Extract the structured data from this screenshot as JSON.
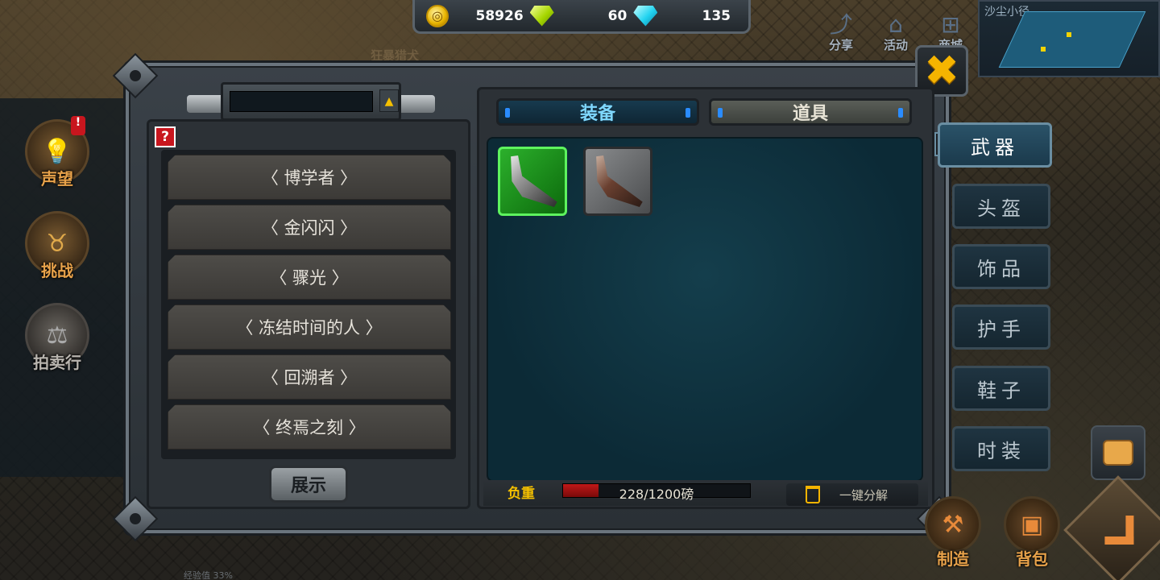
{
  "currency": {
    "gold": "58926",
    "green_gems": "60",
    "blue_gems": "135"
  },
  "top_menu": [
    {
      "label": "分享",
      "icon": "share-icon"
    },
    {
      "label": "活动",
      "icon": "event-gift-icon"
    },
    {
      "label": "商城",
      "icon": "shop-cart-icon"
    }
  ],
  "minimap": {
    "title": "沙尘小径"
  },
  "background": {
    "faded_label": "狂暴猎犬",
    "xp_label": "经验值 33%"
  },
  "side_menu": [
    {
      "label": "声望",
      "icon": "reputation-lightbulb-icon",
      "alert": "!"
    },
    {
      "label": "挑战",
      "icon": "challenge-bull-icon"
    },
    {
      "label": "拍卖行",
      "icon": "auction-scales-icon"
    }
  ],
  "title_panel": {
    "help_label": "?",
    "dropdown_icon": "▲",
    "titles": [
      "〈 博学者 〉",
      "〈 金闪闪 〉",
      "〈 骤光 〉",
      "〈 冻结时间的人 〉",
      "〈 回溯者 〉",
      "〈 终焉之刻 〉"
    ],
    "show_button": "展示"
  },
  "inventory": {
    "tabs": {
      "equipment": "装备",
      "items": "道具"
    },
    "slots": [
      {
        "name": "green-blade",
        "rarity": "green",
        "icon": "blade-icon"
      },
      {
        "name": "rusty-blade",
        "rarity": "grey",
        "icon": "rusty-blade-icon"
      }
    ],
    "weight": {
      "label": "负重",
      "text": "228/1200磅",
      "current": 228,
      "max": 1200
    },
    "dismantle_label": "一键分解"
  },
  "categories": [
    "武器",
    "头盔",
    "饰品",
    "护手",
    "鞋子",
    "时装"
  ],
  "active_category": "武器",
  "bottom_buttons": [
    {
      "label": "制造",
      "icon": "craft-tools-icon"
    },
    {
      "label": "背包",
      "icon": "backpack-icon"
    }
  ],
  "colors": {
    "accent_gold": "#f5b400",
    "equip_tab_text": "#7fd8ff",
    "rarity_green": "#2cb02c",
    "weight_fill": "#c01818"
  }
}
